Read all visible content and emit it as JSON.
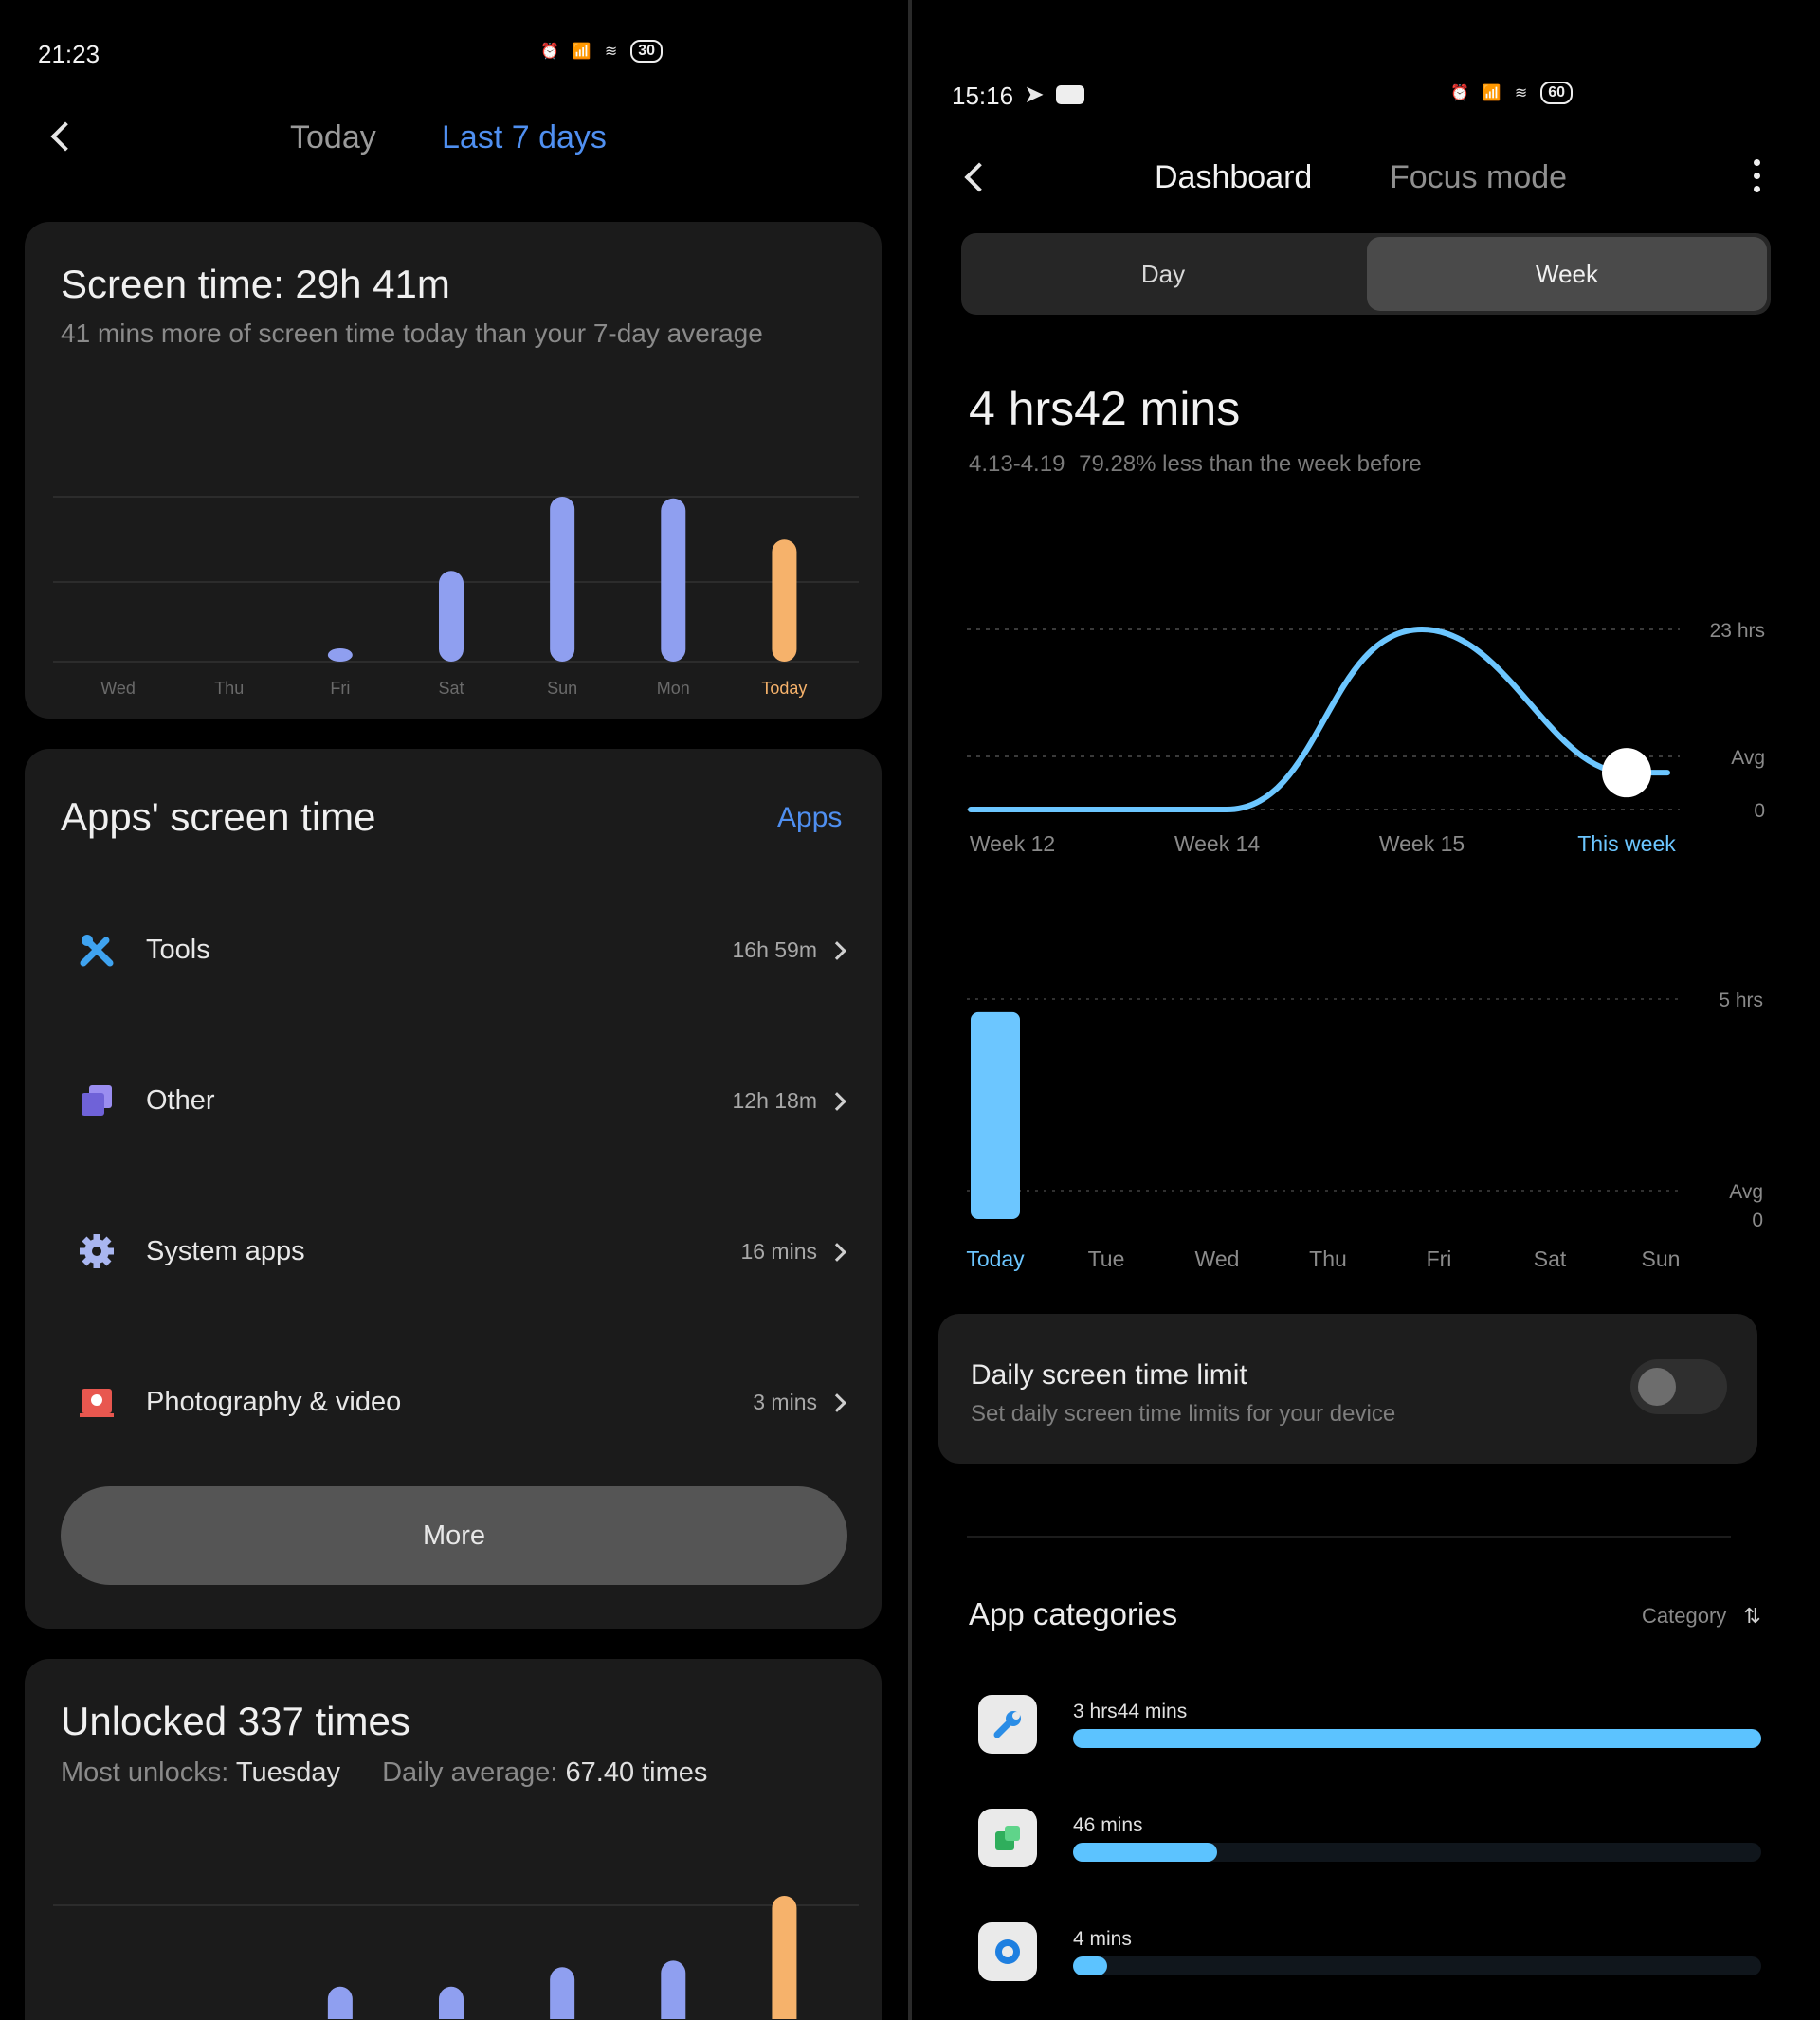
{
  "left": {
    "status": {
      "time": "21:23",
      "battery": "30"
    },
    "tabs": {
      "today": "Today",
      "last7": "Last 7 days"
    },
    "screen_time": {
      "title": "Screen time: 29h 41m",
      "subtitle": "41 mins more of screen time today than your 7-day average"
    },
    "apps_section": {
      "title": "Apps' screen time",
      "link": "Apps",
      "items": [
        {
          "icon": "tools-icon",
          "label": "Tools",
          "value": "16h 59m"
        },
        {
          "icon": "other-icon",
          "label": "Other",
          "value": "12h 18m"
        },
        {
          "icon": "gear-icon",
          "label": "System apps",
          "value": "16 mins"
        },
        {
          "icon": "photo-video-icon",
          "label": "Photography & video",
          "value": "3 mins"
        }
      ],
      "more": "More"
    },
    "unlocked": {
      "title": "Unlocked 337 times",
      "most_label": "Most unlocks:",
      "most_value": "Tuesday",
      "avg_label": "Daily average:",
      "avg_value": "67.40 times"
    }
  },
  "right": {
    "status": {
      "time": "15:16",
      "battery": "60"
    },
    "tabs": {
      "dashboard": "Dashboard",
      "focus": "Focus mode"
    },
    "segment": {
      "day": "Day",
      "week": "Week"
    },
    "total": {
      "value": "4 hrs42 mins",
      "range": "4.13-4.19",
      "compare": "79.28% less than the week before"
    },
    "limit": {
      "title": "Daily screen time limit",
      "subtitle": "Set daily screen time limits for your device"
    },
    "categories": {
      "title": "App categories",
      "sort_label": "Category",
      "items": [
        {
          "icon": "wrench-icon",
          "label": "3 hrs44 mins",
          "fraction": 1.0
        },
        {
          "icon": "green-app-icon",
          "label": "46 mins",
          "fraction": 0.21
        },
        {
          "icon": "blue-app-icon",
          "label": "4 mins",
          "fraction": 0.05
        }
      ]
    }
  },
  "colors": {
    "bar": "#8f9ff0",
    "today_bar": "#f6b26b",
    "week_line": "#6cc6ff",
    "link": "#4f8ff0"
  },
  "chart_data": [
    {
      "type": "bar",
      "title": "",
      "categories": [
        "Wed",
        "Thu",
        "Fri",
        "Sat",
        "Sun",
        "Mon",
        "Today"
      ],
      "values": [
        0,
        0,
        0.5,
        5.5,
        10,
        9.9,
        7.4
      ],
      "ylim": [
        0,
        10
      ],
      "grid": true,
      "highlight": "Today"
    },
    {
      "type": "line",
      "title": "",
      "categories": [
        "Week 12",
        "Week 14",
        "Week 15",
        "This week"
      ],
      "ytick_labels": [
        "23 hrs",
        "Avg",
        "0"
      ],
      "values": [
        0,
        0,
        23,
        4.7
      ],
      "ylim": [
        0,
        23
      ],
      "grid": true
    },
    {
      "type": "bar",
      "title": "",
      "categories": [
        "Today",
        "Tue",
        "Wed",
        "Thu",
        "Fri",
        "Sat",
        "Sun"
      ],
      "ytick_labels": [
        "5 hrs",
        "Avg",
        "0"
      ],
      "values": [
        4.7,
        0,
        0,
        0,
        0,
        0,
        0
      ],
      "ylim": [
        0,
        5
      ],
      "grid": true
    },
    {
      "type": "bar",
      "title": "",
      "categories": [
        "Wed",
        "Thu",
        "Fri",
        "Sat",
        "Sun",
        "Mon",
        "Today"
      ],
      "values": [
        0,
        0,
        25,
        25,
        40,
        45,
        95
      ],
      "grid": true,
      "highlight": "Today"
    }
  ]
}
